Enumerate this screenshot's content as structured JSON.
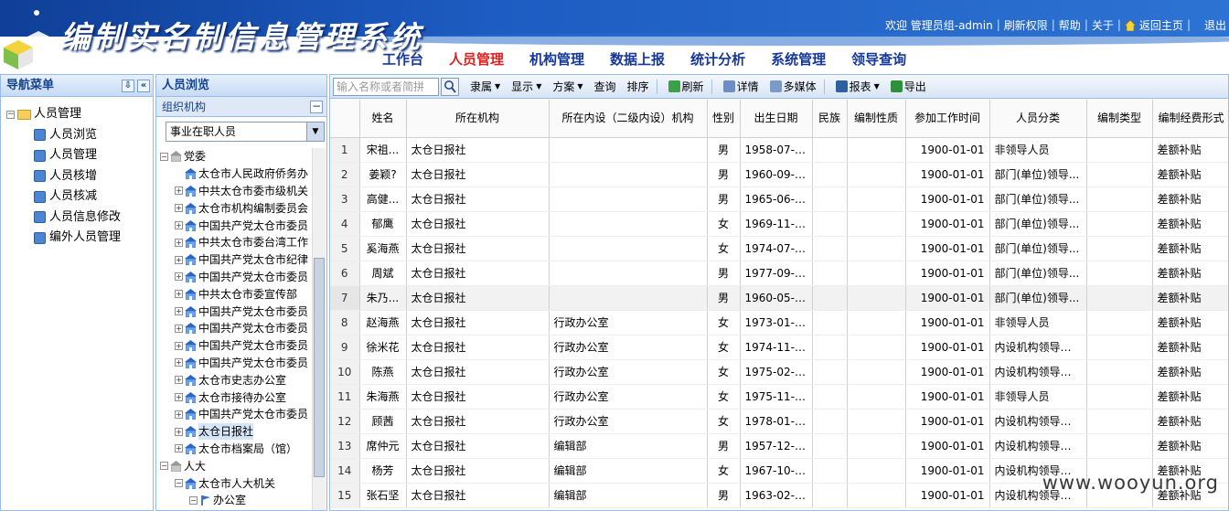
{
  "app": {
    "title": "编制实名制信息管理系统",
    "welcome": "欢迎 管理员组-admin",
    "links": [
      "刷新权限",
      "帮助",
      "关于"
    ],
    "home_label": "返回主页",
    "logout_label": "退出"
  },
  "main_nav": [
    {
      "label": "工作台",
      "active": false
    },
    {
      "label": "人员管理",
      "active": true
    },
    {
      "label": "机构管理",
      "active": false
    },
    {
      "label": "数据上报",
      "active": false
    },
    {
      "label": "统计分析",
      "active": false
    },
    {
      "label": "系统管理",
      "active": false
    },
    {
      "label": "领导查询",
      "active": false
    }
  ],
  "nav_panel": {
    "title": "导航菜单",
    "root": "人员管理",
    "items": [
      "人员浏览",
      "人员管理",
      "人员核增",
      "人员核减",
      "人员信息修改",
      "编外人员管理"
    ]
  },
  "browse_panel": {
    "title": "人员浏览",
    "org_header": "组织机构",
    "status_value": "事业在职人员",
    "tree": [
      {
        "label": "党委",
        "level": 0,
        "pm": "−"
      },
      {
        "label": "太仓市人民政府侨务办",
        "level": 1,
        "pm": ""
      },
      {
        "label": "中共太仓市委市级机关",
        "level": 1,
        "pm": "+"
      },
      {
        "label": "太仓市机构编制委员会",
        "level": 1,
        "pm": "+"
      },
      {
        "label": "中国共产党太仓市委员",
        "level": 1,
        "pm": "+"
      },
      {
        "label": "中共太仓市委台湾工作",
        "level": 1,
        "pm": "+"
      },
      {
        "label": "中国共产党太仓市纪律",
        "level": 1,
        "pm": "+"
      },
      {
        "label": "中国共产党太仓市委员",
        "level": 1,
        "pm": "+"
      },
      {
        "label": "中共太仓市委宣传部",
        "level": 1,
        "pm": "+"
      },
      {
        "label": "中国共产党太仓市委员",
        "level": 1,
        "pm": "+"
      },
      {
        "label": "中国共产党太仓市委员",
        "level": 1,
        "pm": "+"
      },
      {
        "label": "中国共产党太仓市委员",
        "level": 1,
        "pm": "+"
      },
      {
        "label": "中国共产党太仓市委员",
        "level": 1,
        "pm": "+"
      },
      {
        "label": "太仓市史志办公室",
        "level": 1,
        "pm": "+"
      },
      {
        "label": "太仓市接待办公室",
        "level": 1,
        "pm": "+"
      },
      {
        "label": "中国共产党太仓市委员",
        "level": 1,
        "pm": "+"
      },
      {
        "label": "太仓日报社",
        "level": 1,
        "pm": "+",
        "selected": true
      },
      {
        "label": "太仓市档案局（馆）",
        "level": 1,
        "pm": "+"
      },
      {
        "label": "人大",
        "level": 0,
        "pm": "−"
      },
      {
        "label": "太仓市人大机关",
        "level": 1,
        "pm": "−"
      },
      {
        "label": "办公室",
        "level": 2,
        "pm": "−"
      }
    ]
  },
  "toolbar": {
    "search_placeholder": "输入名称或者简拼",
    "items": [
      {
        "label": "隶属",
        "dropdown": true
      },
      {
        "label": "显示",
        "dropdown": true
      },
      {
        "label": "方案",
        "dropdown": true
      },
      {
        "label": "查询",
        "dropdown": false
      },
      {
        "label": "排序",
        "dropdown": false
      },
      {
        "label": "刷新",
        "icon": "refresh-icon"
      },
      {
        "label": "详情",
        "icon": "details-icon"
      },
      {
        "label": "多媒体",
        "icon": "multimedia-icon"
      },
      {
        "label": "报表",
        "icon": "report-icon",
        "dropdown": true
      },
      {
        "label": "导出",
        "icon": "export-icon"
      }
    ]
  },
  "grid": {
    "columns": [
      "",
      "姓名",
      "所在机构",
      "所在内设（二级内设）机构",
      "性别",
      "出生日期",
      "民族",
      "编制性质",
      "参加工作时间",
      "人员分类",
      "编制类型",
      "编制经费形式"
    ],
    "rows": [
      [
        "1",
        "宋祖...",
        "太仓日报社",
        "",
        "男",
        "1958-07-25",
        "",
        "",
        "1900-01-01",
        "非领导人员",
        "",
        "差额补贴"
      ],
      [
        "2",
        "姜颖?",
        "太仓日报社",
        "",
        "男",
        "1960-09-15",
        "",
        "",
        "1900-01-01",
        "部门(单位)领导...",
        "",
        "差额补贴"
      ],
      [
        "3",
        "高健...",
        "太仓日报社",
        "",
        "男",
        "1965-06-27",
        "",
        "",
        "1900-01-01",
        "部门(单位)领导...",
        "",
        "差额补贴"
      ],
      [
        "4",
        "郁鹰",
        "太仓日报社",
        "",
        "女",
        "1969-11-07",
        "",
        "",
        "1900-01-01",
        "部门(单位)领导...",
        "",
        "差额补贴"
      ],
      [
        "5",
        "奚海燕",
        "太仓日报社",
        "",
        "女",
        "1974-07-26",
        "",
        "",
        "1900-01-01",
        "部门(单位)领导...",
        "",
        "差额补贴"
      ],
      [
        "6",
        "周斌",
        "太仓日报社",
        "",
        "男",
        "1977-09-14",
        "",
        "",
        "1900-01-01",
        "部门(单位)领导...",
        "",
        "差额补贴"
      ],
      [
        "7",
        "朱乃...",
        "太仓日报社",
        "",
        "男",
        "1960-05-17",
        "",
        "",
        "1900-01-01",
        "部门(单位)领导...",
        "",
        "差额补贴"
      ],
      [
        "8",
        "赵海燕",
        "太仓日报社",
        "行政办公室",
        "女",
        "1973-01-27",
        "",
        "",
        "1900-01-01",
        "非领导人员",
        "",
        "差额补贴"
      ],
      [
        "9",
        "徐米花",
        "太仓日报社",
        "行政办公室",
        "女",
        "1974-11-09",
        "",
        "",
        "1900-01-01",
        "内设机构领导正职",
        "",
        "差额补贴"
      ],
      [
        "10",
        "陈燕",
        "太仓日报社",
        "行政办公室",
        "女",
        "1975-02-14",
        "",
        "",
        "1900-01-01",
        "内设机构领导副职",
        "",
        "差额补贴"
      ],
      [
        "11",
        "朱海燕",
        "太仓日报社",
        "行政办公室",
        "女",
        "1975-11-01",
        "",
        "",
        "1900-01-01",
        "非领导人员",
        "",
        "差额补贴"
      ],
      [
        "12",
        "顾茜",
        "太仓日报社",
        "行政办公室",
        "女",
        "1978-01-02",
        "",
        "",
        "1900-01-01",
        "内设机构领导副职",
        "",
        "差额补贴"
      ],
      [
        "13",
        "席仲元",
        "太仓日报社",
        "编辑部",
        "男",
        "1957-12-27",
        "",
        "",
        "1900-01-01",
        "内设机构领导副职",
        "",
        "差额补贴"
      ],
      [
        "14",
        "杨芳",
        "太仓日报社",
        "编辑部",
        "女",
        "1967-10-11",
        "",
        "",
        "1900-01-01",
        "内设机构领导副职",
        "",
        "差额补贴"
      ],
      [
        "15",
        "张石坚",
        "太仓日报社",
        "编辑部",
        "男",
        "1963-02-08",
        "",
        "",
        "1900-01-01",
        "内设机构领导副职",
        "",
        "差额补贴"
      ]
    ],
    "highlight_row": 7
  },
  "watermark": "www.wooyun.org",
  "colors": {
    "header_blue": "#1d5cc2",
    "nav_text": "#16389a",
    "nav_active": "#e02020",
    "panel_title": "#15428b"
  }
}
